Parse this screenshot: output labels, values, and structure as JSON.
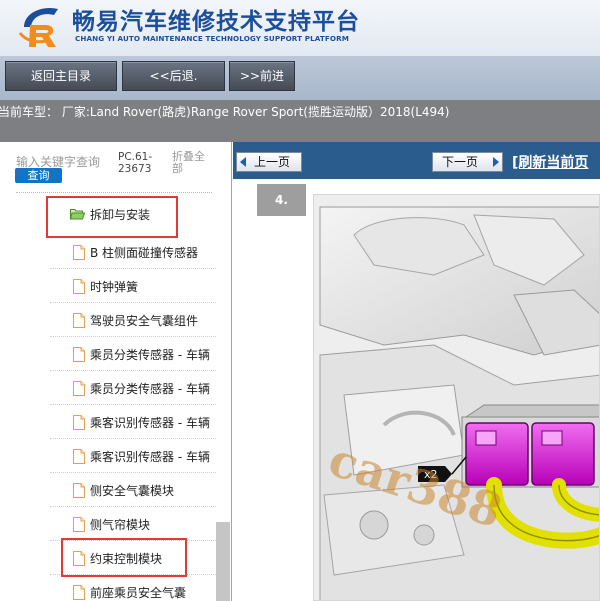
{
  "header": {
    "brand_cn": "畅易汽车维修技术支持平台",
    "brand_en": "CHANG YI AUTO MAINTENANCE TECHNOLOGY SUPPORT PLATFORM",
    "logo_icon": "changyi-logo-icon"
  },
  "nav": {
    "home": "返回主目录",
    "back": "<<后退.",
    "forward": ">>前进"
  },
  "car": {
    "text": "当前车型：  厂家:Land Rover(路虎)Range Rover Sport(揽胜运动版）2018(L494)"
  },
  "sidebar": {
    "search_label": "输入关键字查询",
    "search_button": "查询",
    "pc_code": "PC.61-23673",
    "collapse": "折叠全部",
    "folder_label": "拆卸与安装",
    "items": [
      {
        "label": "B 柱侧面碰撞传感器"
      },
      {
        "label": "时钟弹簧"
      },
      {
        "label": "驾驶员安全气囊组件"
      },
      {
        "label": "乘员分类传感器 - 车辆"
      },
      {
        "label": "乘员分类传感器 - 车辆"
      },
      {
        "label": "乘客识别传感器 - 车辆"
      },
      {
        "label": "乘客识别传感器 - 车辆"
      },
      {
        "label": "侧安全气囊模块"
      },
      {
        "label": "侧气帘模块"
      },
      {
        "label": "约束控制模块"
      },
      {
        "label": "前座乘员安全气囊"
      }
    ],
    "highlight_color": "#e53935"
  },
  "viewer": {
    "prev": "上一页",
    "next": "下一页",
    "refresh": "[刷新当前页",
    "step": "4.",
    "callout": "x2",
    "watermark": "car388",
    "connector_color": "#d400d4",
    "harness_color": "#e2e000"
  }
}
